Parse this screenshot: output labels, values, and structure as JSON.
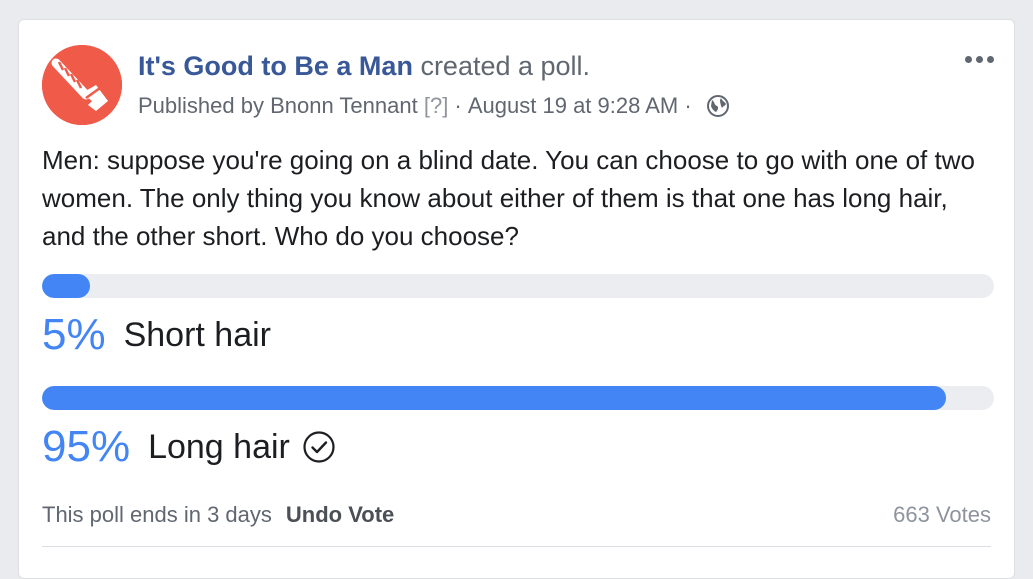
{
  "post": {
    "page_name": "It's Good to Be a Man",
    "action_text": " created a poll.",
    "published_by": "Published by Bnonn Tennant",
    "help_marker": "[?]",
    "timestamp": "August 19 at 9:28 AM",
    "separator": " · ",
    "privacy_icon": "globe-icon",
    "more_icon": "more-options-icon"
  },
  "poll": {
    "question": "Men: suppose you're going on a blind date. You can choose to go with one of two women. The only thing you know about either of them is that one has long hair, and the other short. Who do you choose?",
    "options": [
      {
        "percent_label": "5%",
        "percent": 5,
        "label": "Short hair",
        "selected": false
      },
      {
        "percent_label": "95%",
        "percent": 95,
        "label": "Long hair",
        "selected": true
      }
    ],
    "ends_text": "This poll ends in 3 days",
    "undo_label": "Undo Vote",
    "votes_text": "663 Votes"
  },
  "colors": {
    "accent": "#4385f4",
    "link": "#385898",
    "avatar_bg": "#f05a48"
  }
}
